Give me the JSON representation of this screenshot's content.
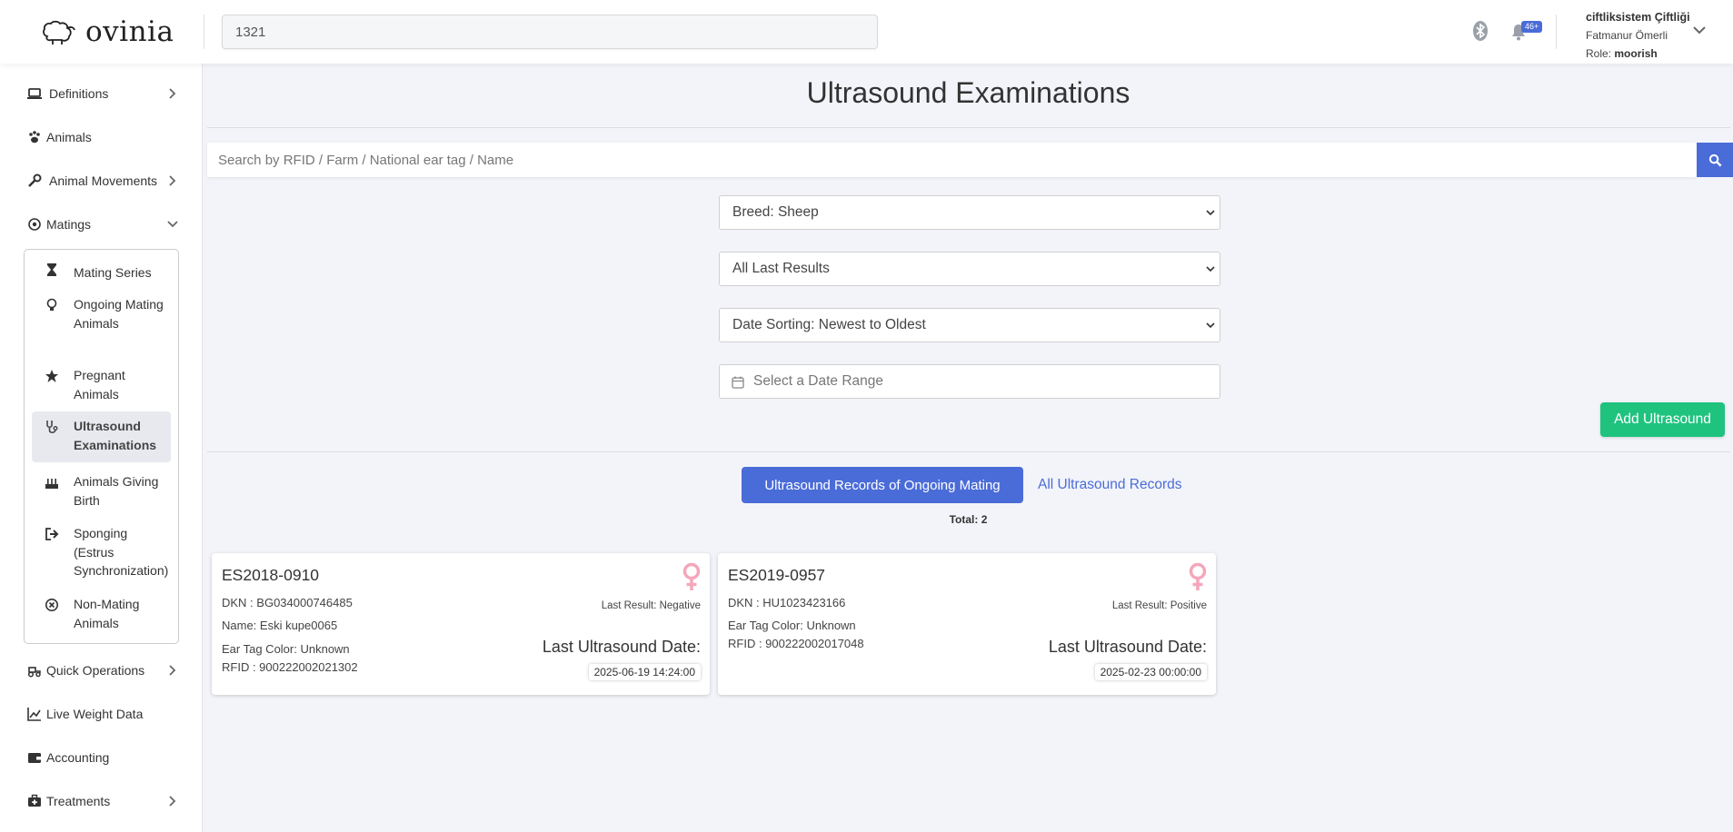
{
  "header": {
    "logo_text": "ovinia",
    "search_value": "1321",
    "notification_badge": "46+",
    "user": {
      "farm": "ciftliksistem Çiftliği",
      "name": "Fatmanur Ömerli",
      "role_label": "Role:",
      "role": "moorish"
    }
  },
  "sidebar": {
    "definitions": "Definitions",
    "animals": "Animals",
    "animal_movements": "Animal Movements",
    "matings": "Matings",
    "sub": {
      "mating_series": "Mating Series",
      "ongoing": "Ongoing Mating Animals",
      "pregnant": "Pregnant Animals",
      "ultrasound": "Ultrasound Examinations",
      "giving_birth": "Animals Giving Birth",
      "sponging": "Sponging (Estrus Synchronization)",
      "non_mating": "Non-Mating Animals"
    },
    "quick_operations": "Quick Operations",
    "live_weight": "Live Weight Data",
    "accounting": "Accounting",
    "treatments": "Treatments"
  },
  "main": {
    "title": "Ultrasound Examinations",
    "search_placeholder": "Search by RFID / Farm / National ear tag / Name",
    "filters": {
      "breed": "Breed: Sheep",
      "last_results": "All Last Results",
      "date_sorting": "Date Sorting: Newest to Oldest",
      "date_range_placeholder": "Select a Date Range"
    },
    "add_button": "Add Ultrasound",
    "tabs": {
      "active": "Ultrasound Records of Ongoing Mating",
      "all": "All Ultrasound Records"
    },
    "total": "Total: 2",
    "cards": [
      {
        "id": "ES2018-0910",
        "dkn": "DKN : BG034000746485",
        "name": "Name: Eski kupe0065",
        "ear_tag": "Ear Tag Color: Unknown",
        "rfid": "RFID : 900222002021302",
        "last_result": "Last Result: Negative",
        "last_date_label": "Last Ultrasound Date:",
        "last_date": "2025-06-19 14:24:00"
      },
      {
        "id": "ES2019-0957",
        "dkn": "DKN : HU1023423166",
        "ear_tag": "Ear Tag Color: Unknown",
        "rfid": "RFID : 900222002017048",
        "last_result": "Last Result: Positive",
        "last_date_label": "Last Ultrasound Date:",
        "last_date": "2025-02-23 00:00:00"
      }
    ]
  },
  "colors": {
    "primary": "#4a6cd8",
    "success": "#1fc37e",
    "female_icon": "#f4a7bb",
    "background": "#f3f4f9"
  }
}
